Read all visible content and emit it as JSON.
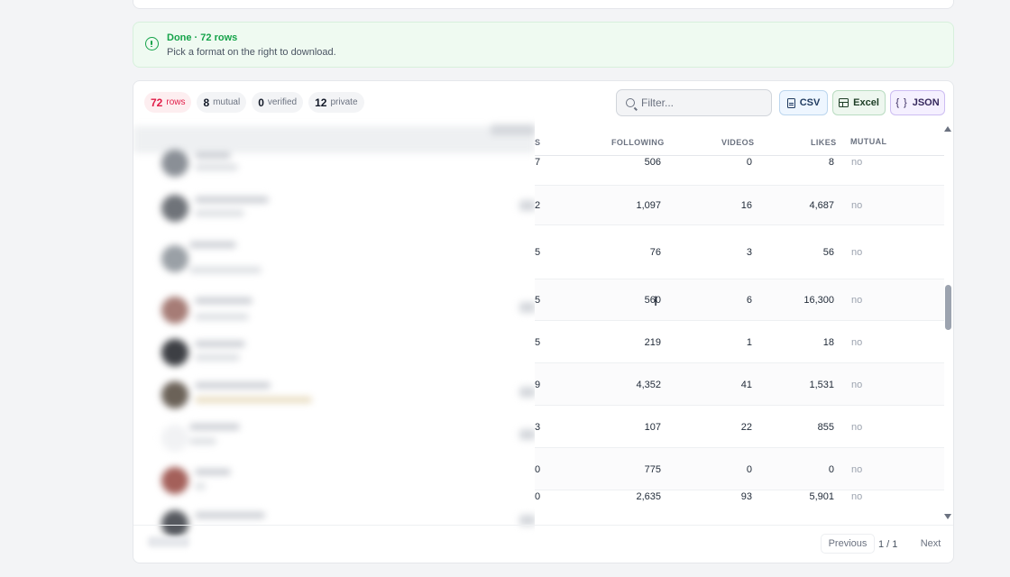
{
  "banner": {
    "title": "Done · 72 rows",
    "subtitle": "Pick a format on the right to download.",
    "icon": "alert-circle-icon",
    "color": "#16a34a"
  },
  "stats": [
    {
      "value": "72",
      "label": "rows",
      "active": true
    },
    {
      "value": "8",
      "label": "mutual",
      "active": false
    },
    {
      "value": "0",
      "label": "verified",
      "active": false
    },
    {
      "value": "12",
      "label": "private",
      "active": false
    }
  ],
  "filter": {
    "placeholder": "Filter...",
    "value": ""
  },
  "exports": {
    "csv": "CSV",
    "excel": "Excel",
    "json": "JSON"
  },
  "table": {
    "headers": {
      "followers_partial": "S",
      "following": "FOLLOWING",
      "videos": "VIDEOS",
      "likes": "LIKES",
      "mutual": "MUTUAL"
    },
    "rows": [
      {
        "followers": "7",
        "following": "506",
        "videos": "0",
        "likes": "8",
        "mutual": "no"
      },
      {
        "followers": "2",
        "following": "1,097",
        "videos": "16",
        "likes": "4,687",
        "mutual": "no"
      },
      {
        "followers": "5",
        "following": "76",
        "videos": "3",
        "likes": "56",
        "mutual": "no"
      },
      {
        "followers": "5",
        "following": "560",
        "videos": "6",
        "likes": "16,300",
        "mutual": "no"
      },
      {
        "followers": "5",
        "following": "219",
        "videos": "1",
        "likes": "18",
        "mutual": "no"
      },
      {
        "followers": "9",
        "following": "4,352",
        "videos": "41",
        "likes": "1,531",
        "mutual": "no"
      },
      {
        "followers": "3",
        "following": "107",
        "videos": "22",
        "likes": "855",
        "mutual": "no"
      },
      {
        "followers": "0",
        "following": "775",
        "videos": "0",
        "likes": "0",
        "mutual": "no"
      },
      {
        "followers": "0",
        "following": "2,635",
        "videos": "93",
        "likes": "5,901",
        "mutual": "no"
      }
    ]
  },
  "pagination": {
    "previous": "Previous",
    "info": "1 / 1",
    "next": "Next"
  }
}
